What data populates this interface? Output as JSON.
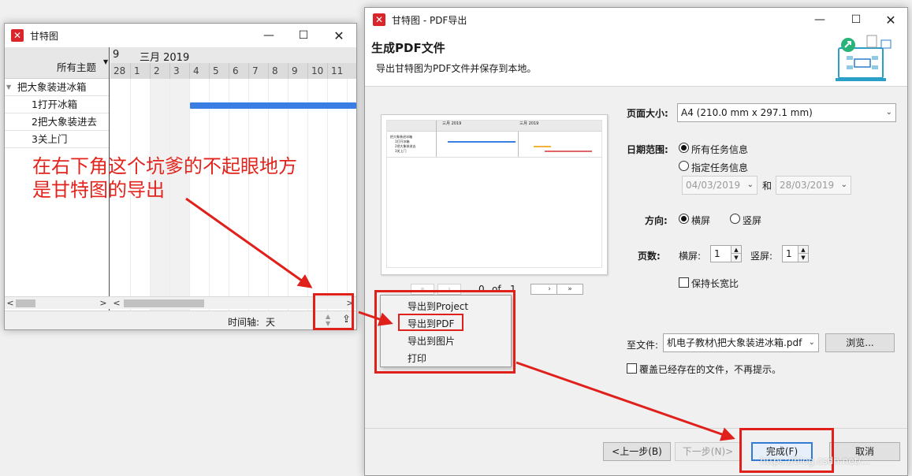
{
  "gantt_window": {
    "title": "甘特图",
    "topics_header": "所有主题",
    "month_prev_fragment": "9",
    "month_label": "三月 2019",
    "day_ticks": [
      "28",
      "1",
      "2",
      "3",
      "4",
      "5",
      "6",
      "7",
      "8",
      "9",
      "10",
      "11"
    ],
    "rows": [
      {
        "label": "把大象装进冰箱",
        "collapsible": true
      },
      {
        "label": "1打开冰箱"
      },
      {
        "label": "2把大象装进去"
      },
      {
        "label": "3关上门"
      }
    ],
    "task_bar_color": "#3a7ee4",
    "timeline_label": "时间轴:",
    "timeline_value": "天"
  },
  "annotation": {
    "line1": "在右下角这个坑爹的不起眼地方",
    "line2": "是甘特图的导出",
    "color": "#e3241d"
  },
  "export_menu": {
    "items": [
      "导出到Project",
      "导出到PDF",
      "导出到图片",
      "打印"
    ],
    "highlighted": "导出到PDF"
  },
  "pdf_dialog": {
    "title": "甘特图 - PDF导出",
    "heading": "生成PDF文件",
    "subheading": "导出甘特图为PDF文件并保存到本地。",
    "page_size_label": "页面大小:",
    "page_size_value": "A4 (210.0 mm x 297.1 mm)",
    "date_range_label": "日期范围:",
    "date_range_all": "所有任务信息",
    "date_range_custom": "指定任务信息",
    "date_from": "04/03/2019",
    "date_and": "和",
    "date_to": "28/03/2019",
    "orientation_label": "方向:",
    "orientation_landscape": "横屏",
    "orientation_portrait": "竖屏",
    "pages_label": "页数:",
    "pages_h_label": "横屏:",
    "pages_h_value": "1",
    "pages_v_label": "竖屏:",
    "pages_v_value": "1",
    "keep_ratio_label": "保持长宽比",
    "file_label": "至文件:",
    "file_value": "机电子教材\\把大象装进冰箱.pdf",
    "browse_button": "浏览...",
    "overwrite_label": "覆盖已经存在的文件，不再提示。",
    "pager": {
      "current": "0",
      "of": "of",
      "total": "1"
    },
    "preview": {
      "month1": "三月 2019",
      "month2": "三月 2019",
      "rows": [
        "把大象装进冰箱",
        "1打开冰箱",
        "2把大象装进去",
        "3关上门"
      ]
    },
    "back_button": "<上一步(B)",
    "next_button": "下一步(N)>",
    "finish_button": "完成(F)",
    "cancel_button": "取消"
  },
  "watermark": "https://blog.csdn.net/..."
}
